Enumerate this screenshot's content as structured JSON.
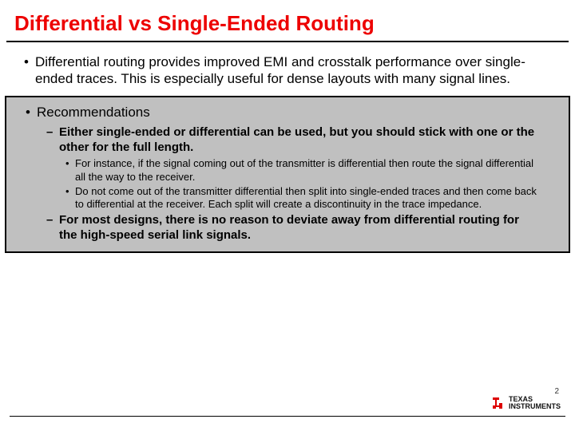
{
  "title": "Differential vs Single-Ended Routing",
  "intro_bullet": "Differential routing provides improved EMI and crosstalk performance over single-ended traces. This is especially useful for dense layouts with many signal lines.",
  "box": {
    "heading": "Recommendations",
    "sub1": "Either single-ended or differential can be used, but you should stick with one or the other for the full length.",
    "sub1_a": "For instance, if the signal coming out of the transmitter is differential then route the signal differential all the way to the receiver.",
    "sub1_b": "Do not come out of the transmitter differential then split into single-ended traces and then come back to differential at the receiver. Each split will create a discontinuity in the trace impedance.",
    "sub2": "For most designs, there is no reason to deviate away from differential routing for the high-speed serial link signals."
  },
  "page_number": "2",
  "logo": {
    "line1": "TEXAS",
    "line2": "INSTRUMENTS"
  }
}
